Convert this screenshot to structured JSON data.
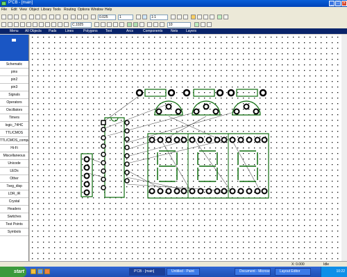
{
  "window": {
    "title": "P'CB - [main]"
  },
  "menu": [
    "File",
    "Edit",
    "View",
    "Object",
    "Library",
    "Tools",
    "Routing",
    "Options",
    "Window",
    "Help"
  ],
  "toolbar": {
    "grid_combo": "0.025",
    "layer_combo": "1",
    "zoom_combo": "1:1",
    "pad_combo": "C.1025",
    "width_combo": "10"
  },
  "tabs": [
    "Menu",
    "All Objects",
    "Pads",
    "Lines",
    "Polygons",
    "Text",
    "Arcs",
    "Components",
    "Nets",
    "Layers"
  ],
  "sidebar": {
    "items": [
      "Schematic",
      "pins",
      "pin2",
      "pin3",
      "Signals",
      "Operators",
      "Oscillators",
      "Timers",
      "logic_74HC",
      "TTL/CMOS",
      "TTL/CMOS_comparators",
      "Hi-Fi",
      "Miscellaneous",
      "Unicode",
      "LEDs",
      "Other",
      "7seg_disp",
      "LDR_IR",
      "Crystal",
      "Headers",
      "Switches",
      "Test Points",
      "Symbols"
    ]
  },
  "status": {
    "coords": "X: 0.000",
    "mode": "Idle"
  },
  "taskbar": {
    "start": "start",
    "tasks": [
      "P'CB - [main]",
      "Untitled - Paint",
      "Document - Microsoft Word",
      "Layout Editor"
    ],
    "clock": "10:22"
  }
}
